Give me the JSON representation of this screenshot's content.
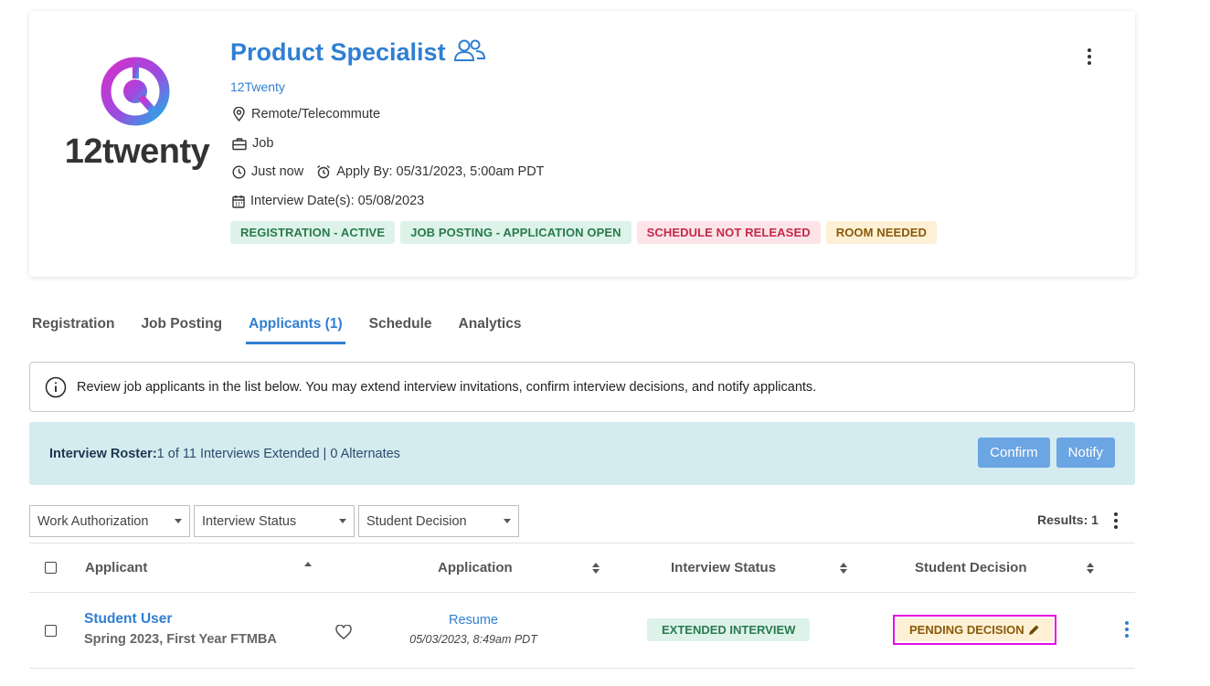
{
  "job": {
    "title": "Product Specialist",
    "company": "12Twenty",
    "location": "Remote/Telecommute",
    "type": "Job",
    "posted": "Just now",
    "apply_by": "Apply By: 05/31/2023, 5:00am PDT",
    "interview_dates": "Interview Date(s): 05/08/2023",
    "logo_text": "12twenty",
    "badges": [
      {
        "label": "REGISTRATION - ACTIVE",
        "color": "#2a7a4d"
      },
      {
        "label": "JOB POSTING - APPLICATION OPEN",
        "color": "#2a7a4d"
      },
      {
        "label": "SCHEDULE NOT RELEASED",
        "color": "#c52a49"
      },
      {
        "label": "ROOM NEEDED",
        "color": "#8a5a08"
      }
    ]
  },
  "tabs": [
    {
      "label": "Registration"
    },
    {
      "label": "Job Posting"
    },
    {
      "label": "Applicants (1)",
      "active": true
    },
    {
      "label": "Schedule"
    },
    {
      "label": "Analytics"
    }
  ],
  "info": {
    "text": "Review job applicants in the list below. You may extend interview invitations, confirm interview decisions, and notify applicants."
  },
  "roster": {
    "label": "Interview Roster:",
    "summary": "1 of 11 Interviews Extended | 0 Alternates",
    "confirm_label": "Confirm",
    "notify_label": "Notify"
  },
  "filters": [
    {
      "label": "Work Authorization"
    },
    {
      "label": "Interview Status"
    },
    {
      "label": "Student Decision"
    }
  ],
  "results": "Results: 1",
  "table": {
    "headers": {
      "applicant": "Applicant",
      "application": "Application",
      "interview_status": "Interview Status",
      "student_decision": "Student Decision"
    },
    "rows": [
      {
        "name": "Student User",
        "program": "Spring 2023, First Year FTMBA",
        "resume_label": "Resume",
        "resume_date": "05/03/2023, 8:49am PDT",
        "interview_status": "EXTENDED INTERVIEW",
        "student_decision": "PENDING DECISION"
      }
    ]
  },
  "colors": {
    "accent": "#2f7fd3",
    "roster_bg": "#d4ebf0",
    "button": "#6ba5e3",
    "highlight": "#e60ee6"
  },
  "icons": [
    "group-icon",
    "location-pin-icon",
    "briefcase-icon",
    "clock-icon",
    "alarm-clock-icon",
    "calendar-icon",
    "info-icon",
    "heart-icon",
    "pencil-icon",
    "kebab-menu-icon"
  ]
}
